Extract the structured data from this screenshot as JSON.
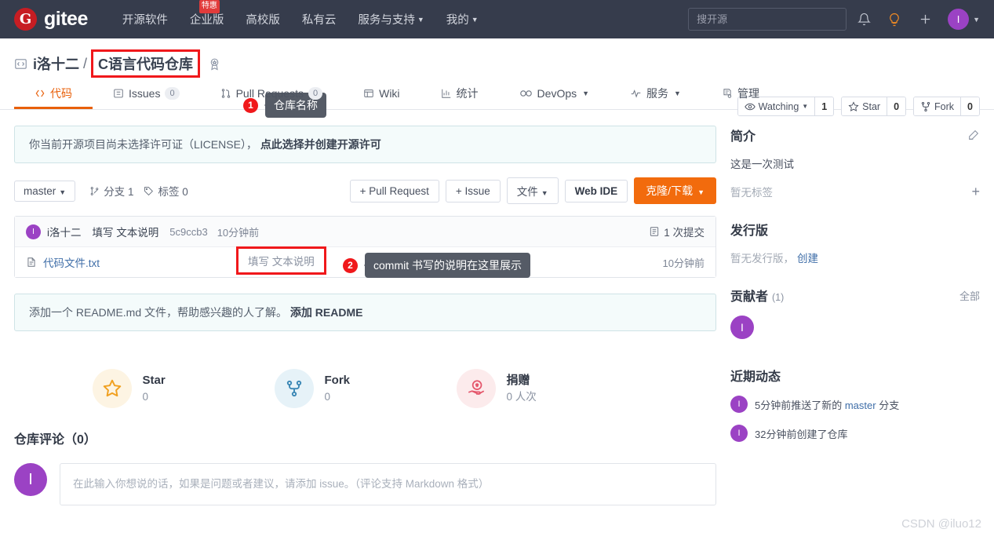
{
  "topnav": {
    "brand": {
      "logo_letter": "G",
      "name": "gitee"
    },
    "links": [
      {
        "label": "开源软件",
        "caret": false,
        "badge": null
      },
      {
        "label": "企业版",
        "caret": false,
        "badge": "特惠"
      },
      {
        "label": "高校版",
        "caret": false,
        "badge": null
      },
      {
        "label": "私有云",
        "caret": false,
        "badge": null
      },
      {
        "label": "服务与支持",
        "caret": true,
        "badge": null
      },
      {
        "label": "我的",
        "caret": true,
        "badge": null
      }
    ],
    "search_placeholder": "搜开源",
    "icons": [
      "bell-icon",
      "lightbulb-icon",
      "plus-icon"
    ],
    "avatar_letter": "I"
  },
  "repo": {
    "code_icon": "repo-code-icon",
    "owner": "i洛十二",
    "separator": "/",
    "name": "C语言代码仓库",
    "badge_icon": "award-icon",
    "stats": [
      {
        "label": "Watching",
        "icon": "eye-icon",
        "caret": true,
        "count": "1"
      },
      {
        "label": "Star",
        "icon": "star-icon",
        "caret": false,
        "count": "0"
      },
      {
        "label": "Fork",
        "icon": "fork-icon",
        "caret": false,
        "count": "0"
      }
    ]
  },
  "annotations": [
    {
      "number": "1",
      "text": "仓库名称"
    },
    {
      "number": "2",
      "text": "commit 书写的说明在这里展示"
    }
  ],
  "tabs": [
    {
      "label": "代码",
      "icon": "code-icon",
      "count": null,
      "active": true,
      "caret": false
    },
    {
      "label": "Issues",
      "icon": "issue-icon",
      "count": "0",
      "active": false,
      "caret": false
    },
    {
      "label": "Pull Requests",
      "icon": "pr-icon",
      "count": "0",
      "active": false,
      "caret": false
    },
    {
      "label": "Wiki",
      "icon": "wiki-icon",
      "count": null,
      "active": false,
      "caret": false
    },
    {
      "label": "统计",
      "icon": "chart-icon",
      "count": null,
      "active": false,
      "caret": false
    },
    {
      "label": "DevOps",
      "icon": "infinity-icon",
      "count": null,
      "active": false,
      "caret": true
    },
    {
      "label": "服务",
      "icon": "pulse-icon",
      "count": null,
      "active": false,
      "caret": true
    },
    {
      "label": "管理",
      "icon": "settings-icon",
      "count": null,
      "active": false,
      "caret": false
    }
  ],
  "license_notice": {
    "text": "你当前开源项目尚未选择许可证（LICENSE），",
    "link": "点此选择并创建开源许可"
  },
  "toolbar": {
    "branch": "master",
    "branch_count_label": "分支 1",
    "tag_count_label": "标签 0",
    "buttons": [
      {
        "label": "+ Pull Request",
        "style": "plain"
      },
      {
        "label": "+ Issue",
        "style": "plain"
      },
      {
        "label": "文件",
        "style": "plain",
        "caret": true
      },
      {
        "label": "Web IDE",
        "style": "bold"
      },
      {
        "label": "克隆/下载",
        "style": "primary",
        "caret": true
      }
    ]
  },
  "commit": {
    "avatar_letter": "I",
    "author": "i洛十二",
    "message": "填写 文本说明",
    "sha": "5c9ccb3",
    "time": "10分钟前",
    "count_label": "1 次提交",
    "count_icon": "commit-icon"
  },
  "files": [
    {
      "icon": "file-icon",
      "name": "代码文件.txt",
      "message": "填写 文本说明",
      "time": "10分钟前"
    }
  ],
  "readme_notice": {
    "text": "添加一个 README.md 文件，帮助感兴趣的人了解。",
    "link": "添加 README"
  },
  "actions": [
    {
      "icon": "star-icon",
      "label": "Star",
      "sub": "0"
    },
    {
      "icon": "fork-icon",
      "label": "Fork",
      "sub": "0"
    },
    {
      "icon": "donate-icon",
      "label": "捐赠",
      "sub": "0 人次"
    }
  ],
  "comments": {
    "title": "仓库评论（0）",
    "avatar_letter": "I",
    "placeholder": "在此输入你想说的话，如果是问题或者建议，请添加 issue。（评论支持 Markdown 格式）"
  },
  "sidebar": {
    "intro": {
      "title": "简介",
      "edit_icon": "edit-icon",
      "description": "这是一次测试",
      "tags_empty": "暂无标签",
      "add_tag_icon": "plus-icon"
    },
    "releases": {
      "title": "发行版",
      "empty": "暂无发行版，",
      "create_link": "创建"
    },
    "contributors": {
      "title": "贡献者",
      "count": "(1)",
      "all_label": "全部",
      "avatars": [
        {
          "letter": "I"
        }
      ]
    },
    "activity": {
      "title": "近期动态",
      "items": [
        {
          "avatar_letter": "I",
          "prefix": "5分钟前推送了新的 ",
          "link": "master",
          "suffix": " 分支"
        },
        {
          "avatar_letter": "I",
          "prefix": "32分钟前创建了仓库",
          "link": "",
          "suffix": ""
        }
      ]
    }
  },
  "watermark": "CSDN @iluo12",
  "colors": {
    "brand_red": "#c71d23",
    "nav_bg": "#363c4c",
    "accent_orange": "#e8600b",
    "primary_btn": "#f26b0d",
    "annotation_red": "#f0181b",
    "avatar_purple": "#9b42c4",
    "link_blue": "#3f6ea8"
  }
}
